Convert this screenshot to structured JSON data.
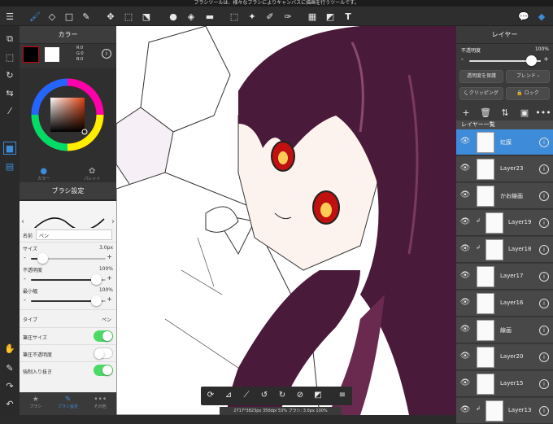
{
  "status_bar": {
    "text": "ブラシツールは、様々なブラシによりキャンバスに描画を行うツールです。"
  },
  "toolbar": {
    "menu_icon": "menu-icon",
    "text_tool_label": "T"
  },
  "color_panel": {
    "title": "カラー",
    "rgb": {
      "r": "R:0",
      "g": "G:0",
      "b": "B:0"
    },
    "tabs": [
      "カラー",
      "パレット"
    ]
  },
  "brush_panel": {
    "title": "ブラシ設定",
    "name_label": "名前",
    "name_value": "ペン",
    "size_label": "サイズ",
    "size_value": "3.0px",
    "opacity_label": "不透明度",
    "opacity_value": "100%",
    "minwidth_label": "最小幅",
    "minwidth_value": "100%",
    "type_label": "タイプ",
    "type_value": "ペン",
    "pressure_size_label": "筆圧サイズ",
    "pressure_opacity_label": "筆圧不透明度",
    "force_taper_label": "強制入り抜き",
    "pressure_size_on": true,
    "pressure_opacity_on": false,
    "force_taper_on": true
  },
  "bottom_tabs": [
    "ブラシ",
    "ブラシ設定",
    "その他"
  ],
  "layer_panel": {
    "title": "レイヤー",
    "opacity_label": "不透明度",
    "opacity_value": "100%",
    "protect_label": "透明度を保護",
    "blend_label": "ブレンド",
    "clipping_label": "クリッピング",
    "lock_label": "ロック",
    "list_title": "レイヤー一覧",
    "layers": [
      {
        "name": "虹膜",
        "selected": true,
        "clip": false
      },
      {
        "name": "Layer23",
        "selected": false,
        "clip": false
      },
      {
        "name": "かお線画",
        "selected": false,
        "clip": false
      },
      {
        "name": "Layer19",
        "selected": false,
        "clip": true
      },
      {
        "name": "Layer18",
        "selected": false,
        "clip": true
      },
      {
        "name": "Layer17",
        "selected": false,
        "clip": false
      },
      {
        "name": "Layer16",
        "selected": false,
        "clip": false
      },
      {
        "name": "線画",
        "selected": false,
        "clip": false
      },
      {
        "name": "Layer20",
        "selected": false,
        "clip": false
      },
      {
        "name": "Layer15",
        "selected": false,
        "clip": false
      },
      {
        "name": "Layer13",
        "selected": false,
        "clip": true
      }
    ]
  },
  "canvas_info": "2717*3823px 350dpi 53% ブラシ: 3.0px 100%",
  "colors": {
    "accent": "#3d8bd9",
    "toggle_on": "#4cd964",
    "hair": "#4a1a3a"
  }
}
